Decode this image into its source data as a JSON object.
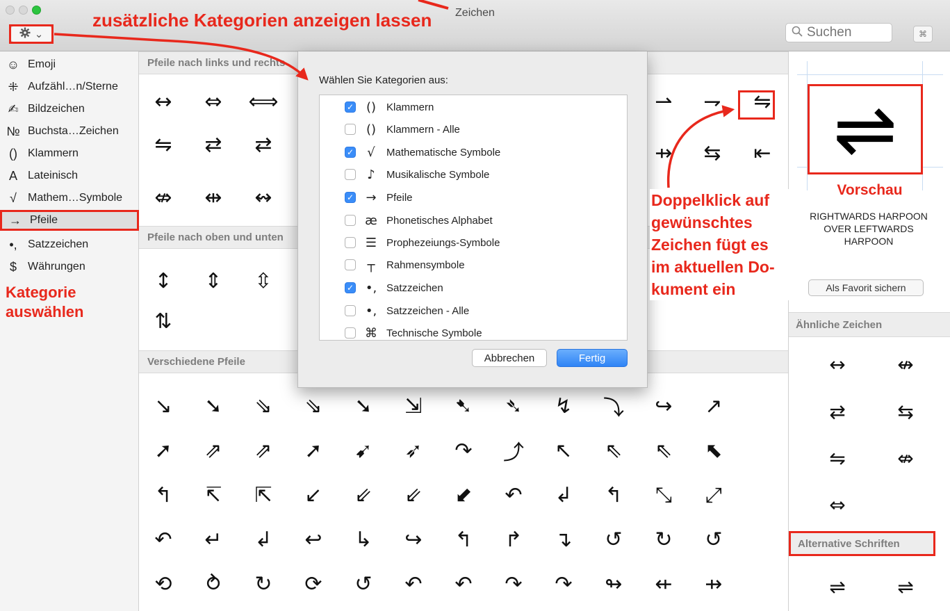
{
  "window": {
    "title": "Zeichen"
  },
  "toolbar": {
    "gear_icon": "gear-icon",
    "chevron": "⌄",
    "search_placeholder": "Suchen",
    "keyboard_label": "⌘"
  },
  "sidebar": {
    "items": [
      {
        "icon": "☺",
        "label": "Emoji"
      },
      {
        "icon": "⁜",
        "label": "Aufzähl…n/Sterne"
      },
      {
        "icon": "✍",
        "label": "Bildzeichen"
      },
      {
        "icon": "№",
        "label": "Buchsta…Zeichen"
      },
      {
        "icon": "()",
        "label": "Klammern"
      },
      {
        "icon": "A",
        "label": "Lateinisch"
      },
      {
        "icon": "√",
        "label": "Mathem…Symbole"
      },
      {
        "icon": "→",
        "label": "Pfeile"
      },
      {
        "icon": "•,",
        "label": "Satzzeichen"
      },
      {
        "icon": "$",
        "label": "Währungen"
      }
    ],
    "selected": "Pfeile"
  },
  "main": {
    "sections": [
      {
        "title": "Pfeile nach links und rechts"
      },
      {
        "title": "Pfeile nach oben und unten"
      },
      {
        "title": "Verschiedene Pfeile"
      }
    ],
    "lr_row1": [
      "↔",
      "⇔",
      "⟺"
    ],
    "lr_row1_right": [
      "⇀",
      "⇁",
      "⇋"
    ],
    "lr_row2": [
      "⇋",
      "⇄",
      "⇄"
    ],
    "lr_row2_right": [
      "⇸",
      "⇆",
      "⇤"
    ],
    "lr_row3": [
      "⇎",
      "⇹",
      "↭"
    ],
    "ud_row1": [
      "↕",
      "⇕",
      "⇳"
    ],
    "ud_row2": [
      "⇅"
    ],
    "misc_rows": [
      [
        "↘",
        "➘",
        "⇘",
        "⇘",
        "➘",
        "⇲",
        "➷",
        "➴",
        "↯",
        "⤵",
        "↪",
        "↗"
      ],
      [
        "➚",
        "⇗",
        "⇗",
        "➚",
        "➹",
        "➶",
        "↷",
        "⤴",
        "↖",
        "⇖",
        "⇖",
        "⬉"
      ],
      [
        "↰",
        "↸",
        "⇱",
        "↙",
        "⇙",
        "⇙",
        "⬋",
        "↶",
        "↲",
        "↰",
        "⤡",
        "⤢"
      ],
      [
        "↶",
        "↵",
        "↲",
        "↩",
        "↳",
        "↪",
        "↰",
        "↱",
        "↴",
        "↺",
        "↻",
        "↺"
      ],
      [
        "⟲",
        "⥁",
        "↻",
        "⟳",
        "↺",
        "↶",
        "↶",
        "↷",
        "↷",
        "↬",
        "⇷",
        "⇸"
      ]
    ]
  },
  "dialog": {
    "title": "Wählen Sie Kategorien aus:",
    "categories": [
      {
        "checked": true,
        "icon": "()",
        "label": "Klammern"
      },
      {
        "checked": false,
        "icon": "()",
        "label": "Klammern - Alle"
      },
      {
        "checked": true,
        "icon": "√",
        "label": "Mathematische Symbole"
      },
      {
        "checked": false,
        "icon": "♪",
        "label": "Musikalische Symbole"
      },
      {
        "checked": true,
        "icon": "→",
        "label": "Pfeile"
      },
      {
        "checked": false,
        "icon": "æ",
        "label": "Phonetisches Alphabet"
      },
      {
        "checked": false,
        "icon": "☰",
        "label": "Prophezeiungs-Symbole"
      },
      {
        "checked": false,
        "icon": "┬",
        "label": "Rahmensymbole"
      },
      {
        "checked": true,
        "icon": "•,",
        "label": "Satzzeichen"
      },
      {
        "checked": false,
        "icon": "•,",
        "label": "Satzzeichen - Alle"
      },
      {
        "checked": false,
        "icon": "⌘",
        "label": "Technische Symbole"
      }
    ],
    "cancel_label": "Abbrechen",
    "done_label": "Fertig"
  },
  "preview": {
    "glyph": "⇌",
    "char_name": "RIGHTWARDS HARPOON OVER LEFTWARDS HARPOON",
    "fav_label": "Als Favorit sichern",
    "similar_title": "Ähnliche Zeichen",
    "similar": [
      "↔",
      "↮",
      "⇄",
      "⇆",
      "⇋",
      "⇎",
      "⇔"
    ],
    "alt_title": "Alternative Schriften",
    "alt_glyphs": [
      "⇌",
      "⇌"
    ]
  },
  "annotations": {
    "top": "zusätzliche Kategorien anzeigen lassen",
    "category_line1": "Kategorie",
    "category_line2": "auswählen",
    "dbl_lines": [
      "Doppelklick auf",
      "gewünschtes",
      "Zeichen fügt es",
      "im aktuellen Do-",
      "kument ein"
    ],
    "preview": "Vorschau"
  },
  "colors": {
    "annotation_red": "#e8281c",
    "checkbox_blue": "#3a8df8",
    "primary_button": "#2f84f5"
  }
}
